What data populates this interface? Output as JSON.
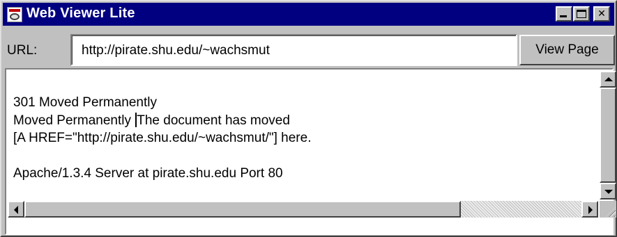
{
  "window": {
    "title": "Web Viewer Lite",
    "title_bar_color": "#000080",
    "controls": {
      "minimize": "minimize-icon",
      "maximize": "maximize-icon",
      "close": "close-icon"
    }
  },
  "toolbar": {
    "url_label": "URL:",
    "url_value": "http://pirate.shu.edu/~wachsmut",
    "view_button_label": "View Page"
  },
  "content": {
    "lines": [
      "301 Moved Permanently",
      "Moved Permanently ",
      "The document has moved",
      "[A HREF=\"http://pirate.shu.edu/~wachsmut/\"] here.",
      "",
      "Apache/1.3.4 Server at pirate.shu.edu Port 80"
    ]
  }
}
